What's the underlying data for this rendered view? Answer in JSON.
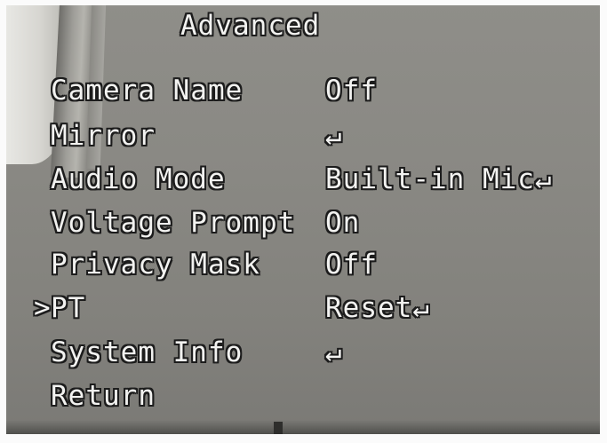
{
  "menu": {
    "title": "Advanced",
    "cursor_symbol": ">",
    "selected_index": 5,
    "enter_symbol": "↵",
    "items": [
      {
        "label": "Camera Name",
        "value": "Off"
      },
      {
        "label": "Mirror",
        "value": "↵"
      },
      {
        "label": "Audio Mode",
        "value": "Built-in Mic↵"
      },
      {
        "label": "Voltage Prompt",
        "value": "On"
      },
      {
        "label": "Privacy Mask",
        "value": "Off"
      },
      {
        "label": "PT",
        "value": "Reset↵"
      },
      {
        "label": "System Info",
        "value": "↵"
      },
      {
        "label": "Return",
        "value": ""
      }
    ]
  },
  "colors": {
    "osd_text": "#f2f2f0",
    "osd_outline": "#1c1c1c",
    "background": "#8a8984"
  }
}
